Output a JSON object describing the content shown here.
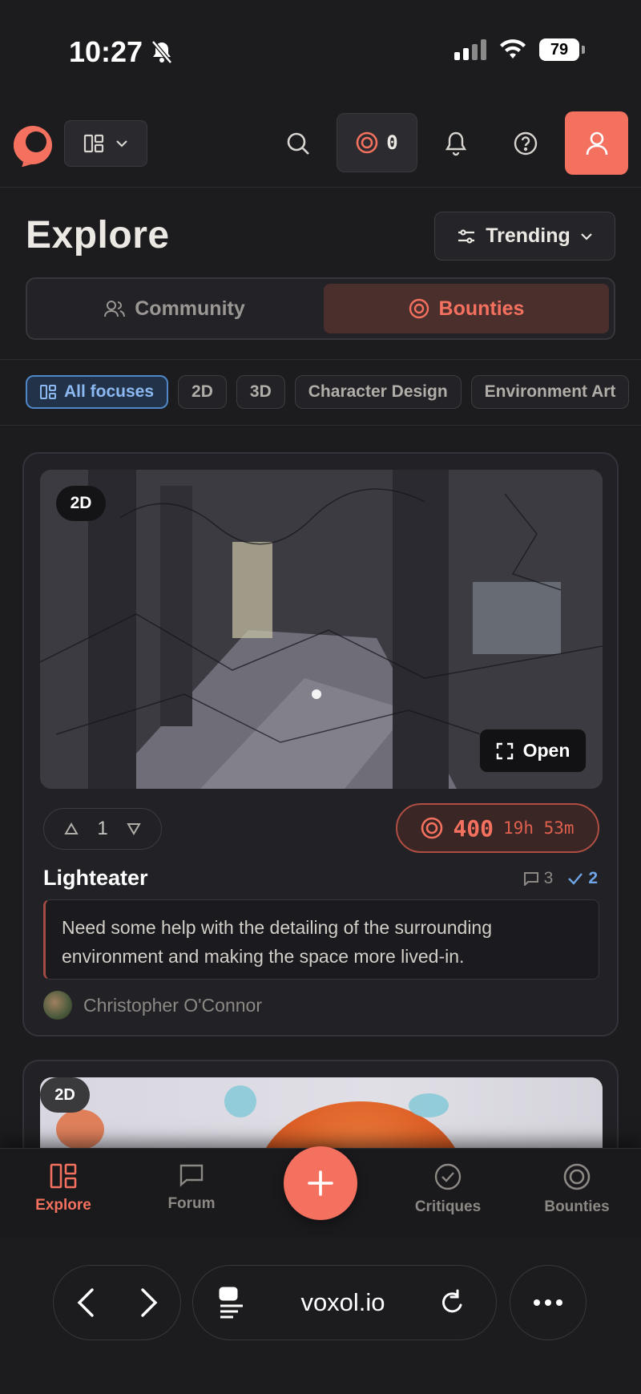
{
  "status_bar": {
    "time": "10:27",
    "battery": "79"
  },
  "nav": {
    "coins": "0"
  },
  "page": {
    "title": "Explore",
    "sort_label": "Trending"
  },
  "tabs_segment": {
    "community": "Community",
    "bounties": "Bounties"
  },
  "filters": [
    "All focuses",
    "2D",
    "3D",
    "Character Design",
    "Environment Art"
  ],
  "card": {
    "tag": "2D",
    "open_label": "Open",
    "votes": "1",
    "bounty_amount": "400",
    "bounty_time": "19h 53m",
    "title": "Lighteater",
    "comments": "3",
    "critiques": "2",
    "description": "Need some help with the detailing of the surrounding environment and making the space more lived-in.",
    "author": "Christopher O'Connor"
  },
  "card2": {
    "tag": "2D"
  },
  "bottom_tabs": {
    "explore": "Explore",
    "forum": "Forum",
    "critiques": "Critiques",
    "bounties": "Bounties"
  },
  "browser": {
    "url": "voxol.io"
  },
  "colors": {
    "accent": "#f4705f",
    "focus_blue": "#4f87c8",
    "background": "#1c1b1e"
  }
}
